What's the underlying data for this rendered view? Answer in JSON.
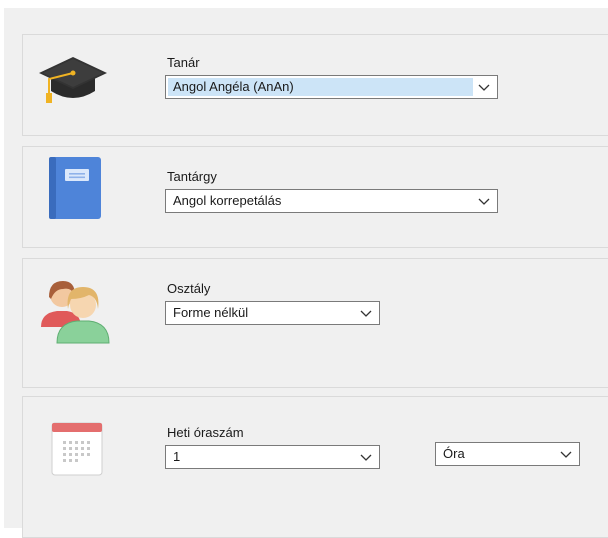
{
  "teacher": {
    "label": "Tanár",
    "value": "Angol Angéla (AnAn)",
    "icon": "graduation-cap-icon"
  },
  "subject": {
    "label": "Tantárgy",
    "value": "Angol korrepetálás",
    "icon": "book-icon"
  },
  "class": {
    "label": "Osztály",
    "value": "Forme nélkül",
    "icon": "people-icon"
  },
  "weekly_hours": {
    "label": "Heti óraszám",
    "value": "1",
    "unit": "Óra",
    "icon": "calendar-icon"
  },
  "colors": {
    "selection": "#cce4f7",
    "background": "#f0f0f0",
    "cap": "#2b2b2b",
    "tassel": "#f0b323",
    "book": "#4e84d9",
    "person_back": "#e05a5a",
    "person_front": "#8ad19a",
    "hair": "#c9925a",
    "calendar_top": "#e46e6e"
  }
}
